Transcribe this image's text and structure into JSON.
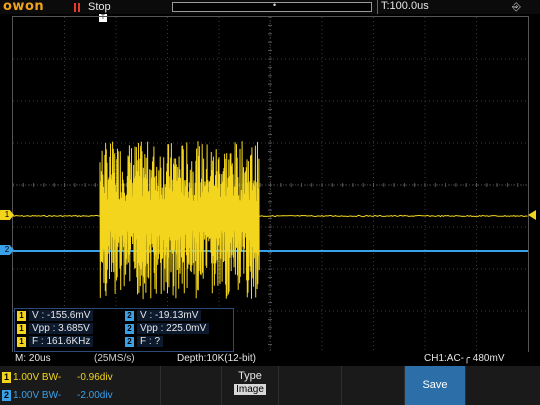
{
  "header": {
    "brand": "owon",
    "run_state": "Stop",
    "timebase_readout": "T:100.0us"
  },
  "measurements": {
    "ch1_v": "V : -155.6mV",
    "ch1_vpp": "Vpp : 3.685V",
    "ch1_f": "F : 161.6KHz",
    "ch2_v": "V : -19.13mV",
    "ch2_vpp": "Vpp : 225.0mV",
    "ch2_f": "F : ?",
    "ch1_badge": "1",
    "ch2_badge": "2"
  },
  "status": {
    "timebase": "M: 20us",
    "sample_rate": "(25MS/s)",
    "depth": "Depth:10K(12-bit)",
    "trigger": "CH1:AC-╭ 480mV"
  },
  "channels": {
    "ch1": {
      "num": "1",
      "setting": "1.00V BW-",
      "offset": "-0.96div",
      "color": "#f2d51c"
    },
    "ch2": {
      "num": "2",
      "setting": "1.00V BW-",
      "offset": "-2.00div",
      "color": "#3aa0e8"
    }
  },
  "softkeys": {
    "type_title": "Type",
    "type_value": "Image",
    "save_label": "Save"
  },
  "markers": {
    "ch1": "1",
    "ch2": "2",
    "trigger_top": "T"
  },
  "icons": {
    "pause": "pause-icon",
    "usb": "usb-icon"
  }
}
